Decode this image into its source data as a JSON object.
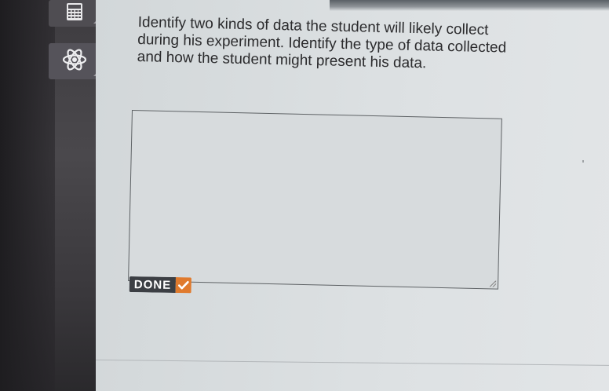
{
  "toolbar": {
    "calculator_tool": "calculator-icon",
    "reference_tool": "atom-icon"
  },
  "question": {
    "text": "Identify two kinds of data the student will likely collect during his experiment. Identify the type of data collected and how the student might present his data."
  },
  "answer": {
    "value": ""
  },
  "done_button": {
    "label": "DONE"
  },
  "colors": {
    "done_accent": "#e07a2d",
    "done_bg": "#3c3f44",
    "sidebar_bg": "#4a484c"
  }
}
